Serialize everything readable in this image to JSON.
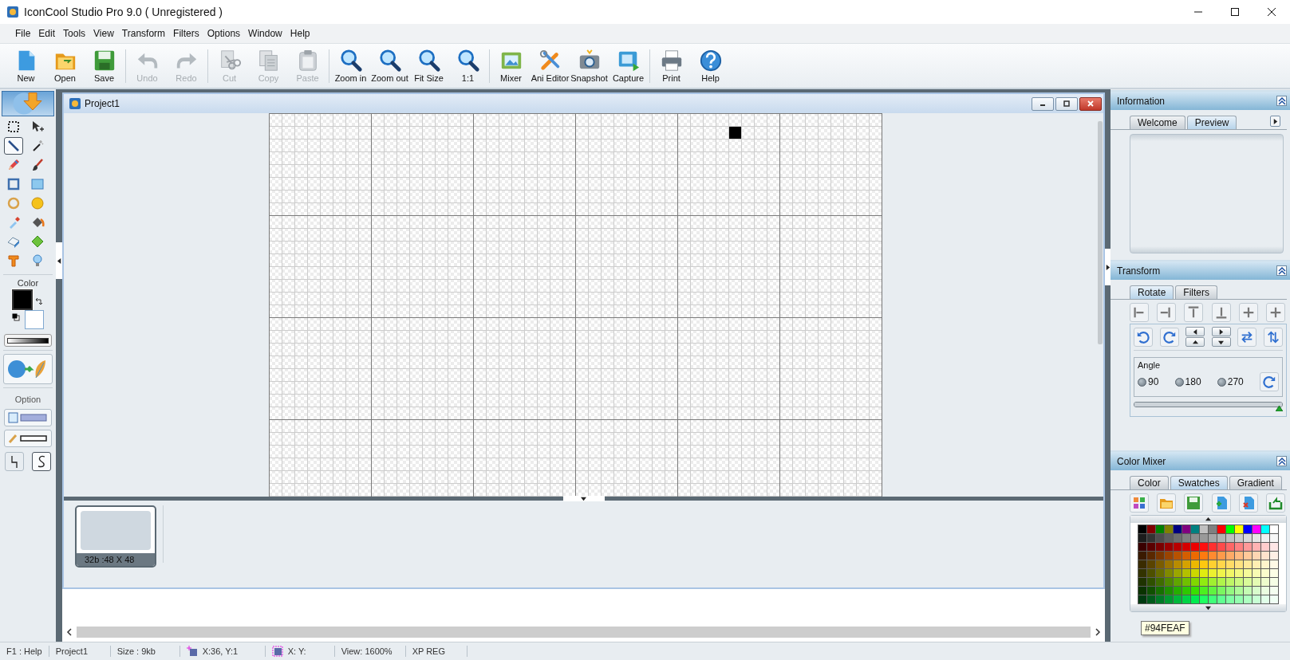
{
  "window": {
    "title": "IconCool Studio Pro  9.0 ( Unregistered )"
  },
  "menu": [
    "File",
    "Edit",
    "Tools",
    "View",
    "Transform",
    "Filters",
    "Options",
    "Window",
    "Help"
  ],
  "toolbar": [
    [
      {
        "label": "New",
        "disabled": false
      },
      {
        "label": "Open",
        "disabled": false
      },
      {
        "label": "Save",
        "disabled": false
      }
    ],
    [
      {
        "label": "Undo",
        "disabled": true
      },
      {
        "label": "Redo",
        "disabled": true
      }
    ],
    [
      {
        "label": "Cut",
        "disabled": true
      },
      {
        "label": "Copy",
        "disabled": true
      },
      {
        "label": "Paste",
        "disabled": true
      }
    ],
    [
      {
        "label": "Zoom in",
        "disabled": false
      },
      {
        "label": "Zoom out",
        "disabled": false
      },
      {
        "label": "Fit Size",
        "disabled": false
      },
      {
        "label": "1:1",
        "disabled": false
      }
    ],
    [
      {
        "label": "Mixer",
        "disabled": false
      },
      {
        "label": "Ani Editor",
        "disabled": false
      },
      {
        "label": "Snapshot",
        "disabled": false
      },
      {
        "label": "Capture",
        "disabled": false
      }
    ],
    [
      {
        "label": "Print",
        "disabled": false
      },
      {
        "label": "Help",
        "disabled": false
      }
    ]
  ],
  "tools": [
    {
      "selected": false
    },
    {
      "selected": false
    },
    {
      "selected": true
    },
    {
      "selected": false
    },
    {
      "selected": false
    },
    {
      "selected": false
    },
    {
      "selected": false
    },
    {
      "selected": false
    },
    {
      "selected": false
    },
    {
      "selected": false
    },
    {
      "selected": false
    },
    {
      "selected": false
    },
    {
      "selected": false
    },
    {
      "selected": false
    },
    {
      "selected": false
    },
    {
      "selected": false
    }
  ],
  "color_panel": {
    "label": "Color",
    "colors": [
      {
        "color": "#000000"
      },
      {
        "color": "#ffffff"
      }
    ],
    "option_label": "Option",
    "options": [
      {
        "selected": false
      },
      {
        "selected": true
      }
    ]
  },
  "document": {
    "title": "Project1",
    "frames": [
      {
        "label": "32b :48 X 48",
        "selected": true
      }
    ]
  },
  "information": {
    "title": "Information",
    "tabs": [
      {
        "label": "Welcome",
        "selected": false
      },
      {
        "label": "Preview",
        "selected": true
      }
    ]
  },
  "transform": {
    "title": "Transform",
    "tabs": [
      {
        "label": "Rotate",
        "selected": true
      },
      {
        "label": "Filters",
        "selected": false
      }
    ],
    "angle": {
      "label": "Angle",
      "options": [
        {
          "label": "90",
          "selected": false
        },
        {
          "label": "180",
          "selected": false
        },
        {
          "label": "270",
          "selected": false
        }
      ]
    },
    "slider": {
      "level": 1
    }
  },
  "color_mixer": {
    "title": "Color Mixer",
    "tabs": [
      {
        "label": "Color",
        "selected": false
      },
      {
        "label": "Swatches",
        "selected": true
      },
      {
        "label": "Gradient",
        "selected": false
      }
    ],
    "swatch_rows": [
      [
        {
          "color": "#000000"
        },
        {
          "color": "#800000"
        },
        {
          "color": "#008000"
        },
        {
          "color": "#808000"
        },
        {
          "color": "#000080"
        },
        {
          "color": "#800080"
        },
        {
          "color": "#008080"
        },
        {
          "color": "#c0c0c0"
        },
        {
          "color": "#808080"
        },
        {
          "color": "#ff0000"
        },
        {
          "color": "#00ff00"
        },
        {
          "color": "#ffff00"
        },
        {
          "color": "#0000ff"
        },
        {
          "color": "#ff00ff"
        },
        {
          "color": "#00ffff"
        },
        {
          "color": "#ffffff"
        }
      ],
      [
        {
          "color": "#1c1c1c"
        },
        {
          "color": "#333333"
        },
        {
          "color": "#4d4d4d"
        },
        {
          "color": "#5f5f5f"
        },
        {
          "color": "#6e6e6e"
        },
        {
          "color": "#7f7f7f"
        },
        {
          "color": "#8c8c8c"
        },
        {
          "color": "#999999"
        },
        {
          "color": "#a5a5a5"
        },
        {
          "color": "#b2b2b2"
        },
        {
          "color": "#bfbfbf"
        },
        {
          "color": "#cccccc"
        },
        {
          "color": "#d8d8d8"
        },
        {
          "color": "#e5e5e5"
        },
        {
          "color": "#f0f0f0"
        },
        {
          "color": "#f8f8f8"
        }
      ],
      [
        {
          "color": "#3a0000"
        },
        {
          "color": "#5a0000"
        },
        {
          "color": "#7a0000"
        },
        {
          "color": "#9a0000"
        },
        {
          "color": "#b80000"
        },
        {
          "color": "#d40000"
        },
        {
          "color": "#ec0000"
        },
        {
          "color": "#ff1010"
        },
        {
          "color": "#ff3030"
        },
        {
          "color": "#ff4a4a"
        },
        {
          "color": "#ff6666"
        },
        {
          "color": "#ff8080"
        },
        {
          "color": "#ff9999"
        },
        {
          "color": "#ffb3b3"
        },
        {
          "color": "#ffcccc"
        },
        {
          "color": "#ffe6e6"
        }
      ],
      [
        {
          "color": "#3a1a00"
        },
        {
          "color": "#5a2800"
        },
        {
          "color": "#7a3600"
        },
        {
          "color": "#9a4400"
        },
        {
          "color": "#b85200"
        },
        {
          "color": "#d45e00"
        },
        {
          "color": "#ec6a00"
        },
        {
          "color": "#ff7a10"
        },
        {
          "color": "#ff8a30"
        },
        {
          "color": "#ff9a4a"
        },
        {
          "color": "#ffaa66"
        },
        {
          "color": "#ffba80"
        },
        {
          "color": "#ffc999"
        },
        {
          "color": "#ffd6b3"
        },
        {
          "color": "#ffe3cc"
        },
        {
          "color": "#fff0e6"
        }
      ],
      [
        {
          "color": "#3a2c00"
        },
        {
          "color": "#5a4400"
        },
        {
          "color": "#7a5c00"
        },
        {
          "color": "#9a7400"
        },
        {
          "color": "#b88c00"
        },
        {
          "color": "#d4a200"
        },
        {
          "color": "#ecb800"
        },
        {
          "color": "#ffc810"
        },
        {
          "color": "#ffd030"
        },
        {
          "color": "#ffd64a"
        },
        {
          "color": "#ffdc66"
        },
        {
          "color": "#ffe280"
        },
        {
          "color": "#ffe899"
        },
        {
          "color": "#ffeeb3"
        },
        {
          "color": "#fff4cc"
        },
        {
          "color": "#fffae6"
        }
      ],
      [
        {
          "color": "#333300"
        },
        {
          "color": "#4d5000"
        },
        {
          "color": "#666c00"
        },
        {
          "color": "#808a00"
        },
        {
          "color": "#9aa600"
        },
        {
          "color": "#b4c000"
        },
        {
          "color": "#ccd800"
        },
        {
          "color": "#e0ec10"
        },
        {
          "color": "#ecf030"
        },
        {
          "color": "#f0f44a"
        },
        {
          "color": "#f2f666"
        },
        {
          "color": "#f4f880"
        },
        {
          "color": "#f6fa99"
        },
        {
          "color": "#f8fbb3"
        },
        {
          "color": "#fafccc"
        },
        {
          "color": "#fcfee6"
        }
      ],
      [
        {
          "color": "#1f3300"
        },
        {
          "color": "#2f5000"
        },
        {
          "color": "#3f6c00"
        },
        {
          "color": "#508a00"
        },
        {
          "color": "#60a600"
        },
        {
          "color": "#70c000"
        },
        {
          "color": "#80d800"
        },
        {
          "color": "#90ec10"
        },
        {
          "color": "#a0f030"
        },
        {
          "color": "#b0f44a"
        },
        {
          "color": "#bff666"
        },
        {
          "color": "#ccf880"
        },
        {
          "color": "#d9fa99"
        },
        {
          "color": "#e4fbb3"
        },
        {
          "color": "#eefccc"
        },
        {
          "color": "#f6fee6"
        }
      ],
      [
        {
          "color": "#0a3300"
        },
        {
          "color": "#105000"
        },
        {
          "color": "#167000"
        },
        {
          "color": "#1e9000"
        },
        {
          "color": "#26ae00"
        },
        {
          "color": "#2ec800"
        },
        {
          "color": "#38e000"
        },
        {
          "color": "#4cf020"
        },
        {
          "color": "#60f440"
        },
        {
          "color": "#7af660"
        },
        {
          "color": "#94f880"
        },
        {
          "color": "#aefa99"
        },
        {
          "color": "#c4fbb3"
        },
        {
          "color": "#d8fccc"
        },
        {
          "color": "#eafde0"
        },
        {
          "color": "#f4fef0"
        }
      ],
      [
        {
          "color": "#003a10"
        },
        {
          "color": "#005a1a"
        },
        {
          "color": "#007a26"
        },
        {
          "color": "#009a30"
        },
        {
          "color": "#00b83a"
        },
        {
          "color": "#00d444"
        },
        {
          "color": "#00ec4e"
        },
        {
          "color": "#20ff60"
        },
        {
          "color": "#40ff78"
        },
        {
          "color": "#60ff90"
        },
        {
          "color": "#80ffa4"
        },
        {
          "color": "#94feaf"
        },
        {
          "color": "#aeffc0"
        },
        {
          "color": "#c8ffd4"
        },
        {
          "color": "#e0ffe8"
        },
        {
          "color": "#f0fff4"
        }
      ]
    ],
    "tooltip": "#94FEAF"
  },
  "status_bar": [
    {
      "text": "F1 : Help",
      "kind": "text"
    },
    {
      "text": "Project1",
      "kind": "text"
    },
    {
      "text": "Size : 9kb",
      "kind": "text"
    },
    {
      "text": "X:36, Y:1",
      "kind": "cursor"
    },
    {
      "text": "X: Y:",
      "kind": "selection"
    },
    {
      "text": "View: 1600%",
      "kind": "text"
    },
    {
      "text": "XP REG",
      "kind": "text"
    }
  ]
}
